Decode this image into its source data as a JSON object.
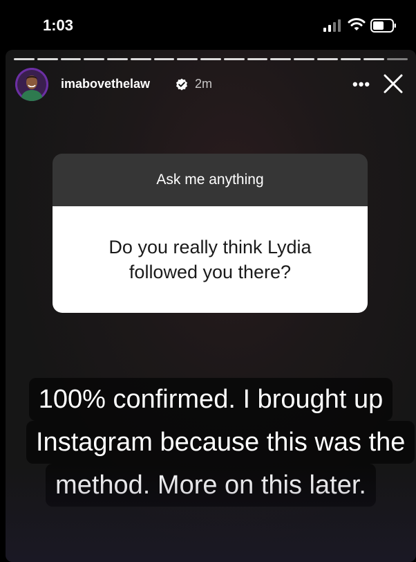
{
  "status_bar": {
    "time": "1:03",
    "icons": [
      "signal-icon",
      "wifi-icon",
      "battery-icon"
    ]
  },
  "story": {
    "progress_segments": 17,
    "username": "imabovethelaw",
    "verified": true,
    "posted_ago": "2m",
    "more_icon": "more-icon",
    "more_label": "•••",
    "close_icon": "close-icon"
  },
  "question_sticker": {
    "prompt": "Ask me anything",
    "question": "Do you really think Lydia followed you there?"
  },
  "answer": {
    "lines": [
      "100% confirmed. I brought up",
      "Instagram because this was the",
      "method. More on this later."
    ]
  },
  "colors": {
    "background": "#000000",
    "story_background": "#161616",
    "sticker_header": "#363636",
    "sticker_body": "#ffffff",
    "avatar_ring": "#6b2fa3"
  }
}
